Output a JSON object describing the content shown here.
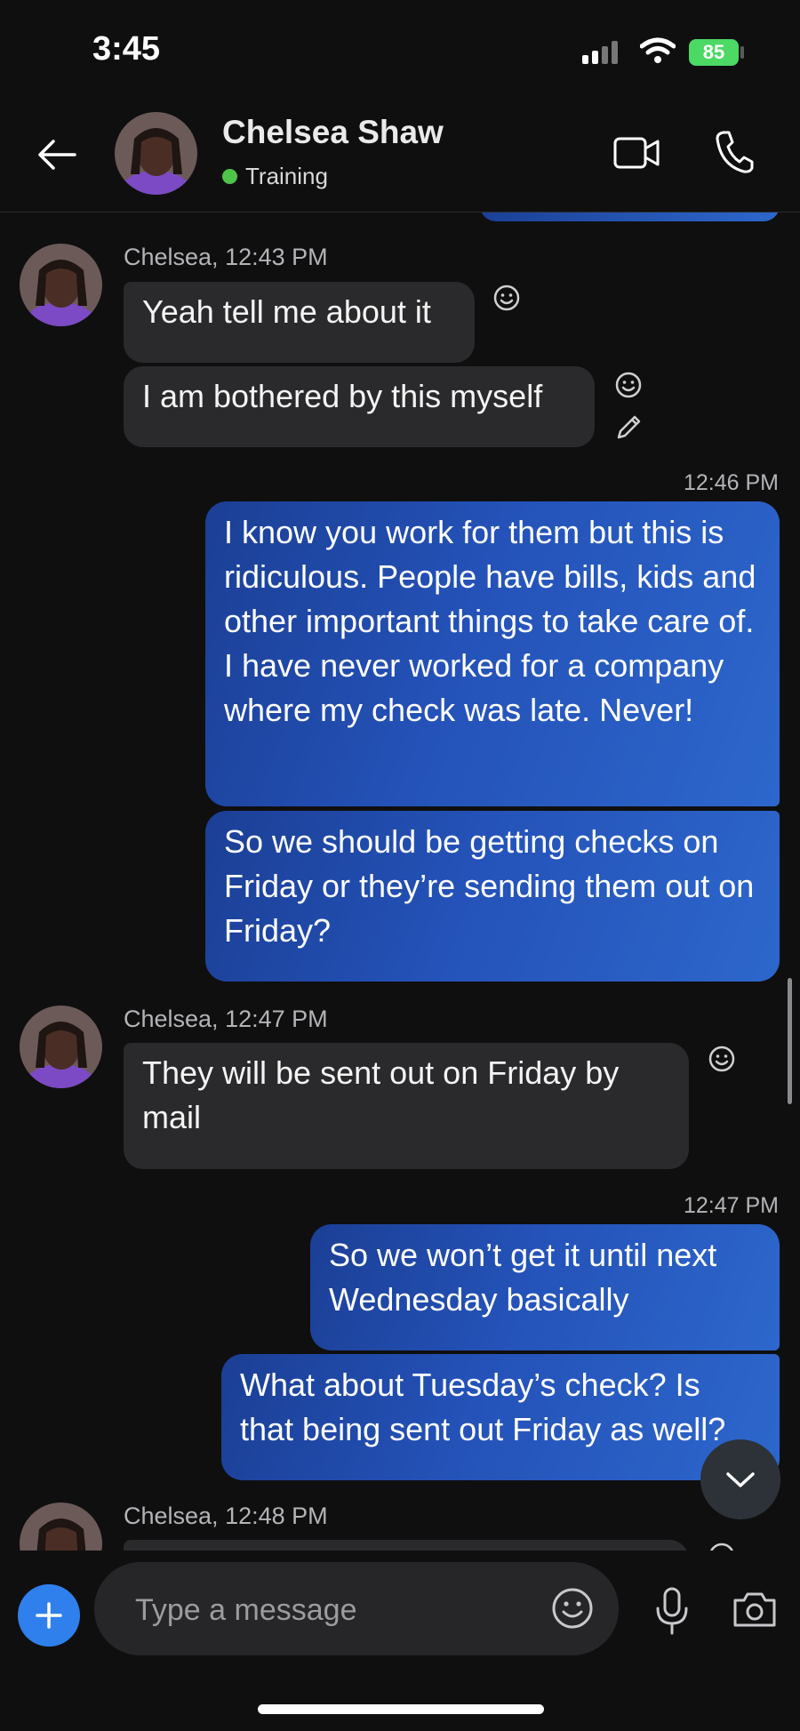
{
  "status_bar": {
    "time": "3:45",
    "battery": "85"
  },
  "header": {
    "contact_name": "Chelsea Shaw",
    "presence": "Training",
    "presence_color": "#4ec44a",
    "icons": [
      "back-arrow-icon",
      "video-call-icon",
      "phone-call-icon"
    ]
  },
  "messages": [
    {
      "sender_meta": "Chelsea, 12:43 PM",
      "text": "Yeah tell me about it",
      "direction": "incoming"
    },
    {
      "text": "I am bothered by this myself",
      "direction": "incoming"
    },
    {
      "time": "12:46 PM",
      "text": "I know you work for them but this is ridiculous. People have bills, kids and other important things to take care of. I have never worked for a company where my check was late. Never!",
      "direction": "outgoing"
    },
    {
      "text": "So we should be getting checks on Friday or they’re sending them out on Friday?",
      "direction": "outgoing"
    },
    {
      "sender_meta": "Chelsea, 12:47 PM",
      "text": "They will be sent out on Friday by mail",
      "direction": "incoming"
    },
    {
      "time": "12:47 PM",
      "text": "So we won’t get it until next Wednesday basically",
      "direction": "outgoing"
    },
    {
      "text": "What about Tuesday’s check? Is that being sent out Friday as well?",
      "direction": "outgoing"
    },
    {
      "sender_meta": "Chelsea, 12:48 PM",
      "text": "",
      "direction": "incoming"
    }
  ],
  "composer": {
    "placeholder": "Type a message"
  },
  "colors": {
    "background": "#0f0f10",
    "incoming_bubble": "#2a2a2c",
    "outgoing_bubble_start": "#1b3f95",
    "outgoing_bubble_end": "#2d67cc",
    "accent": "#2f80ed"
  }
}
